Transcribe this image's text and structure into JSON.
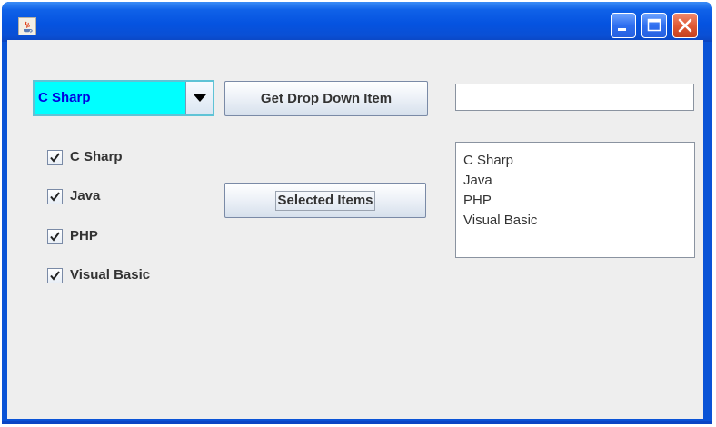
{
  "window": {
    "title": "",
    "icon": "java-coffee-cup-icon",
    "controls": [
      "minimize",
      "maximize",
      "close"
    ]
  },
  "combo": {
    "selected": "C Sharp",
    "arrow_icon": "chevron-down-icon",
    "background": "#00ffff",
    "text_color": "#0000e0"
  },
  "buttons": {
    "get_dropdown": "Get Drop Down Item",
    "selected_items": "Selected Items"
  },
  "textfield": {
    "value": ""
  },
  "checkboxes": [
    {
      "label": "C Sharp",
      "checked": true
    },
    {
      "label": "Java",
      "checked": true
    },
    {
      "label": "PHP",
      "checked": true
    },
    {
      "label": "Visual Basic",
      "checked": true
    }
  ],
  "list": {
    "items": [
      "C Sharp",
      "Java",
      "PHP",
      "Visual Basic"
    ]
  }
}
